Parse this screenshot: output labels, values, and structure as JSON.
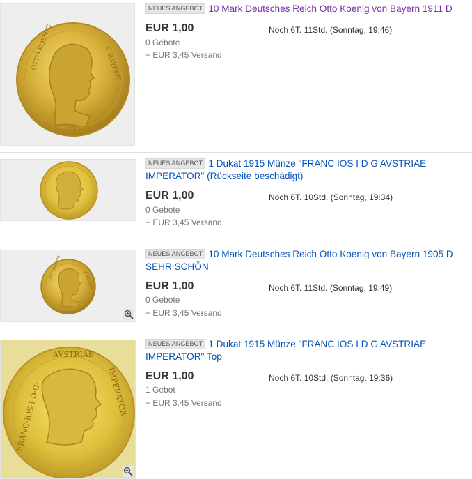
{
  "listings": [
    {
      "badge": "NEUES ANGEBOT",
      "title": "10 Mark Deutsches Reich Otto Koenig von Bayern 1911 D",
      "price": "EUR 1,00",
      "bids": "0 Gebote",
      "shipping": "+ EUR 3,45 Versand",
      "time_left": "Noch 6T. 11Std. (Sonntag, 19:46)",
      "coin_legend_left": "OTTO KOENIG",
      "coin_legend_right": "V. BAYERN",
      "mint_mark": "D"
    },
    {
      "badge": "NEUES ANGEBOT",
      "title": "1 Dukat 1915 Münze \"FRANC IOS I D G AVSTRIAE IMPERATOR\" (Rückseite beschädigt)",
      "price": "EUR 1,00",
      "bids": "0 Gebote",
      "shipping": "+ EUR 3,45 Versand",
      "time_left": "Noch 6T. 10Std. (Sonntag, 19:34)"
    },
    {
      "badge": "NEUES ANGEBOT",
      "title": "10 Mark Deutsches Reich Otto Koenig von Bayern 1905 D SEHR SCHÖN",
      "price": "EUR 1,00",
      "bids": "0 Gebote",
      "shipping": "+ EUR 3,45 Versand",
      "time_left": "Noch 6T. 11Std. (Sonntag, 19:49)",
      "coin_legend_left": "OTTO KOENIG",
      "coin_legend_right": "V. BAYERN"
    },
    {
      "badge": "NEUES ANGEBOT",
      "title": "1 Dukat 1915 Münze \"FRANC IOS I D G AVSTRIAE IMPERATOR\" Top",
      "price": "EUR 1,00",
      "bids": "1 Gebot",
      "shipping": "+ EUR 3,45 Versand",
      "time_left": "Noch 6T. 10Std. (Sonntag, 19:36)",
      "coin_legend_left": "FRANC·IOS·I·D·G·",
      "coin_legend_top": "AVSTRIAE",
      "coin_legend_right": "IMPERATOR"
    }
  ],
  "icons": {
    "zoom": "magnifier-plus-icon"
  },
  "colors": {
    "link": "#0654ba",
    "visited_link": "#7a2fa5",
    "gold": "#d6b23a"
  }
}
